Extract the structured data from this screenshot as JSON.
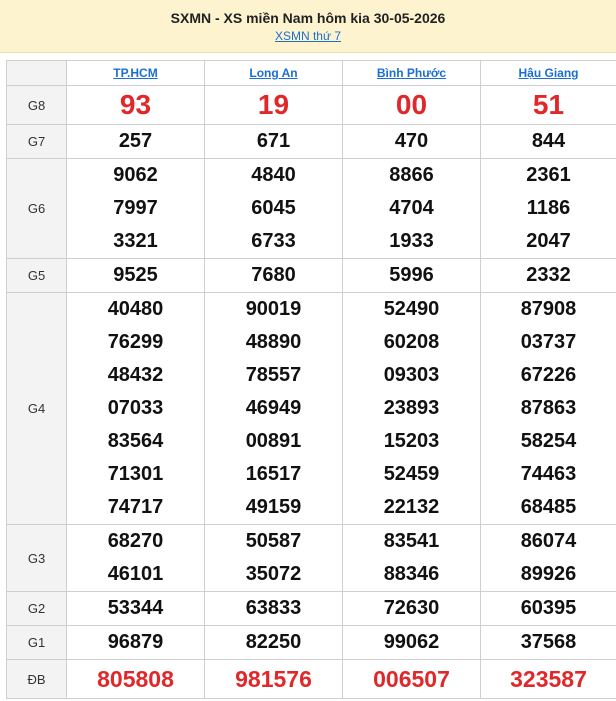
{
  "header": {
    "title": "SXMN - XS miền Nam hôm kia 30-05-2026",
    "subtitle": "XSMN thứ 7"
  },
  "columns": [
    "TP.HCM",
    "Long An",
    "Bình Phước",
    "Hậu Giang"
  ],
  "rows": [
    {
      "label": "G8",
      "values": [
        [
          "93"
        ],
        [
          "19"
        ],
        [
          "00"
        ],
        [
          "51"
        ]
      ]
    },
    {
      "label": "G7",
      "values": [
        [
          "257"
        ],
        [
          "671"
        ],
        [
          "470"
        ],
        [
          "844"
        ]
      ]
    },
    {
      "label": "G6",
      "values": [
        [
          "9062",
          "7997",
          "3321"
        ],
        [
          "4840",
          "6045",
          "6733"
        ],
        [
          "8866",
          "4704",
          "1933"
        ],
        [
          "2361",
          "1186",
          "2047"
        ]
      ]
    },
    {
      "label": "G5",
      "values": [
        [
          "9525"
        ],
        [
          "7680"
        ],
        [
          "5996"
        ],
        [
          "2332"
        ]
      ]
    },
    {
      "label": "G4",
      "values": [
        [
          "40480",
          "76299",
          "48432",
          "07033",
          "83564",
          "71301",
          "74717"
        ],
        [
          "90019",
          "48890",
          "78557",
          "46949",
          "00891",
          "16517",
          "49159"
        ],
        [
          "52490",
          "60208",
          "09303",
          "23893",
          "15203",
          "52459",
          "22132"
        ],
        [
          "87908",
          "03737",
          "67226",
          "87863",
          "58254",
          "74463",
          "68485"
        ]
      ]
    },
    {
      "label": "G3",
      "values": [
        [
          "68270",
          "46101"
        ],
        [
          "50587",
          "35072"
        ],
        [
          "83541",
          "88346"
        ],
        [
          "86074",
          "89926"
        ]
      ]
    },
    {
      "label": "G2",
      "values": [
        [
          "53344"
        ],
        [
          "63833"
        ],
        [
          "72630"
        ],
        [
          "60395"
        ]
      ]
    },
    {
      "label": "G1",
      "values": [
        [
          "96879"
        ],
        [
          "82250"
        ],
        [
          "99062"
        ],
        [
          "37568"
        ]
      ]
    },
    {
      "label": "ĐB",
      "values": [
        [
          "805808"
        ],
        [
          "981576"
        ],
        [
          "006507"
        ],
        [
          "323587"
        ]
      ]
    }
  ],
  "colors": {
    "prize_red": "#e0282a",
    "link_blue": "#1a6fd0",
    "header_bg": "#fdf4cf"
  }
}
